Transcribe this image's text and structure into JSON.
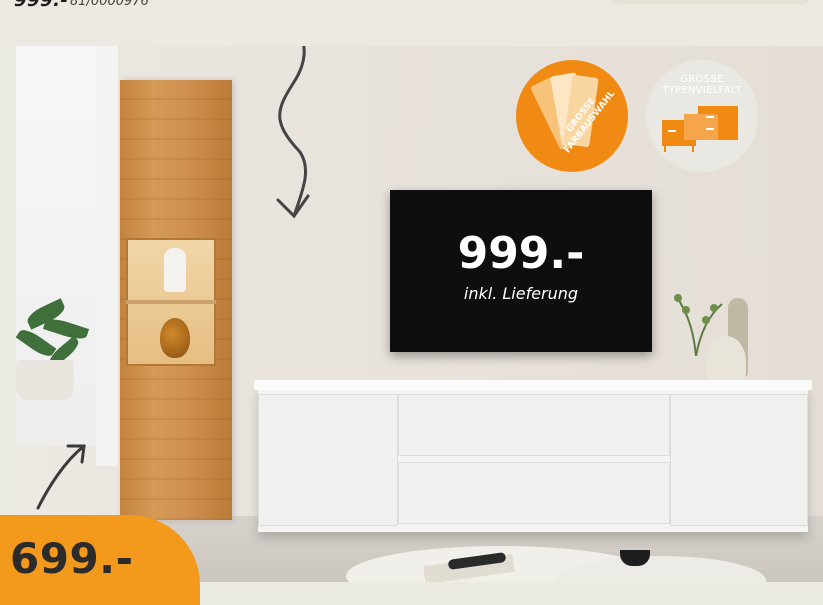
{
  "top": {
    "price": "999.-",
    "article_number": "81/0000976"
  },
  "tv": {
    "price": "999.-",
    "note": "inkl. Lieferung"
  },
  "badges": {
    "color_choice": "GROSSE FARBAUSWAHL",
    "type_variety_line1": "GROSSE",
    "type_variety_line2": "TYPENVIELFALT"
  },
  "bottom_price": {
    "price": "699.-"
  },
  "colors": {
    "accent_orange": "#f08a12",
    "price_bubble": "#f39a1c",
    "wood": "#cf9050",
    "sideboard_white": "#f4f4f2",
    "tv_black": "#0e0e0e"
  },
  "icons": [
    "color-fan-icon",
    "sideboard-icon",
    "sketch-arrow-down-icon",
    "sketch-arrow-up-icon"
  ]
}
